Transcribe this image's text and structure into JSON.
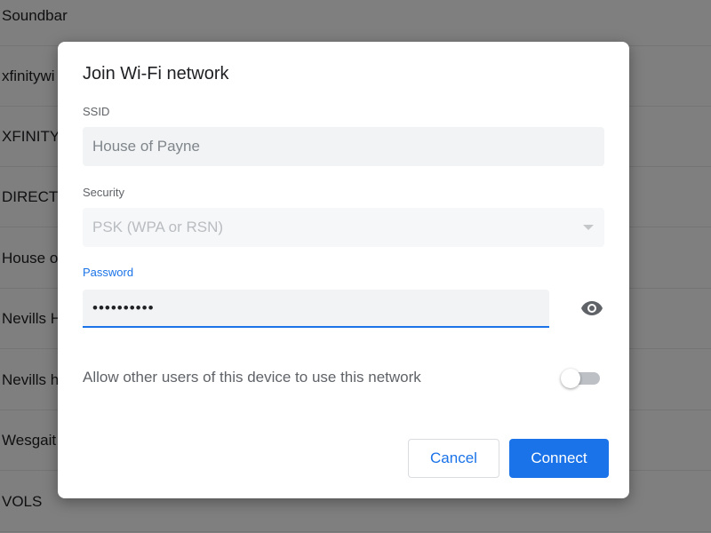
{
  "background_networks": [
    {
      "name": "Soundbar"
    },
    {
      "name": "xfinitywi"
    },
    {
      "name": "XFINITY"
    },
    {
      "name": "DIRECT-"
    },
    {
      "name": "House o"
    },
    {
      "name": "Nevills H"
    },
    {
      "name": "Nevills h"
    },
    {
      "name": "Wesgait"
    },
    {
      "name": "VOLS"
    }
  ],
  "dialog": {
    "title": "Join Wi-Fi network",
    "ssid_label": "SSID",
    "ssid_value": "House of Payne",
    "security_label": "Security",
    "security_value": "PSK (WPA or RSN)",
    "password_label": "Password",
    "password_value": "••••••••••",
    "share_label": "Allow other users of this device to use this network",
    "share_enabled": false,
    "cancel_label": "Cancel",
    "connect_label": "Connect"
  },
  "colors": {
    "accent": "#1a73e8",
    "scrim": "rgba(0,0,0,0.5)"
  },
  "icons": {
    "password_visibility": "eye-icon",
    "security_dropdown": "chevron-down-icon"
  }
}
